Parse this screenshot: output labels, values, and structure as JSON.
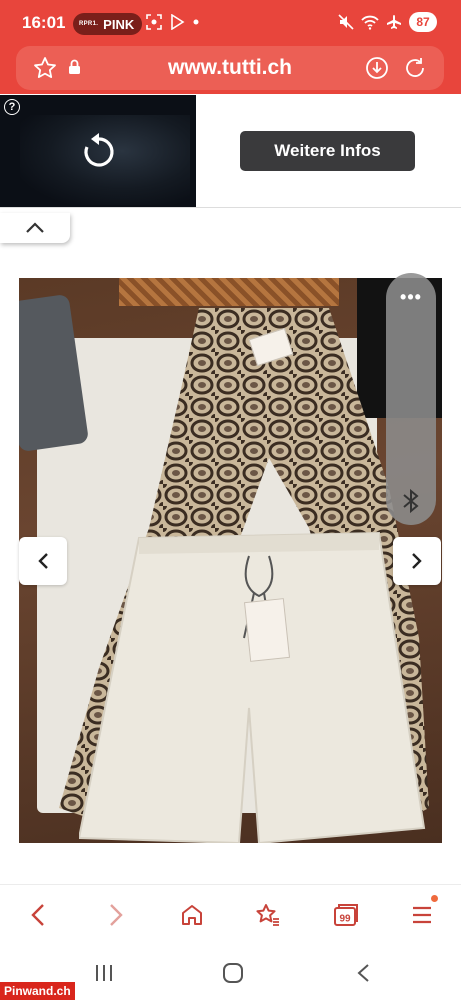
{
  "status_bar": {
    "time": "16:01",
    "radio_label": "PINK",
    "radio_logo_text": "RPR1.",
    "battery": "87"
  },
  "browser": {
    "url": "www.tutti.ch",
    "accent_color": "#e8453c"
  },
  "ad": {
    "help_label": "?",
    "button_label": "Weitere Infos"
  },
  "gallery": {
    "icons": {
      "collapse": "chevron-up-icon",
      "prev": "chevron-left-icon",
      "next": "chevron-right-icon",
      "more": "more-dots-icon",
      "bluetooth": "bluetooth-icon"
    },
    "more_label": "•••"
  },
  "toolbar": {
    "tab_count": "99",
    "icons": [
      "back-icon",
      "forward-icon",
      "home-icon",
      "bookmark-star-icon",
      "tabs-icon",
      "menu-icon"
    ],
    "notification_color": "#ef6a3d"
  },
  "system_nav": {
    "icons": [
      "recents-icon",
      "home-circle-icon",
      "back-triangle-icon"
    ]
  },
  "watermark": "Pinwand.ch"
}
